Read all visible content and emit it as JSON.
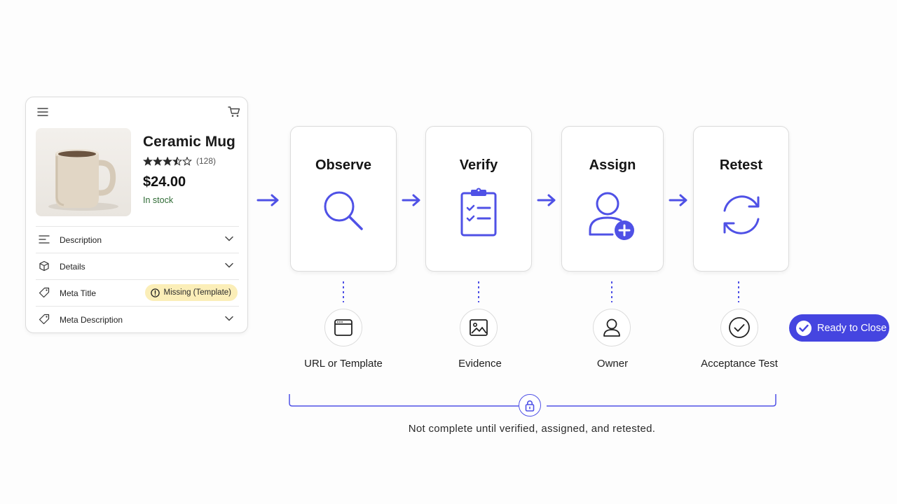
{
  "product": {
    "title": "Ceramic Mug",
    "rating_count": "(128)",
    "rating": 3.5,
    "price": "$24.00",
    "stock": "In stock",
    "rows": [
      {
        "label": "Description",
        "icon": "text-lines-icon"
      },
      {
        "label": "Details",
        "icon": "box-icon"
      },
      {
        "label": "Meta Title",
        "icon": "tag-icon",
        "badge": "Missing (Template)"
      },
      {
        "label": "Meta Description",
        "icon": "tag-icon"
      }
    ]
  },
  "steps": [
    {
      "title": "Observe",
      "icon": "magnifier-icon",
      "sub_label": "URL or Template",
      "sub_icon": "browser-window-icon"
    },
    {
      "title": "Verify",
      "icon": "clipboard-checklist-icon",
      "sub_label": "Evidence",
      "sub_icon": "image-icon"
    },
    {
      "title": "Assign",
      "icon": "add-user-icon",
      "sub_label": "Owner",
      "sub_icon": "user-icon"
    },
    {
      "title": "Retest",
      "icon": "refresh-icon",
      "sub_label": "Acceptance Test",
      "sub_icon": "check-circle-icon"
    }
  ],
  "ready_label": "Ready to Close",
  "footer_note": "Not complete until verified, assigned, and retested.",
  "colors": {
    "accent": "#4f51e6",
    "pill": "#4545e0",
    "badge": "#fbeeb8",
    "stock": "#2f6b35"
  }
}
